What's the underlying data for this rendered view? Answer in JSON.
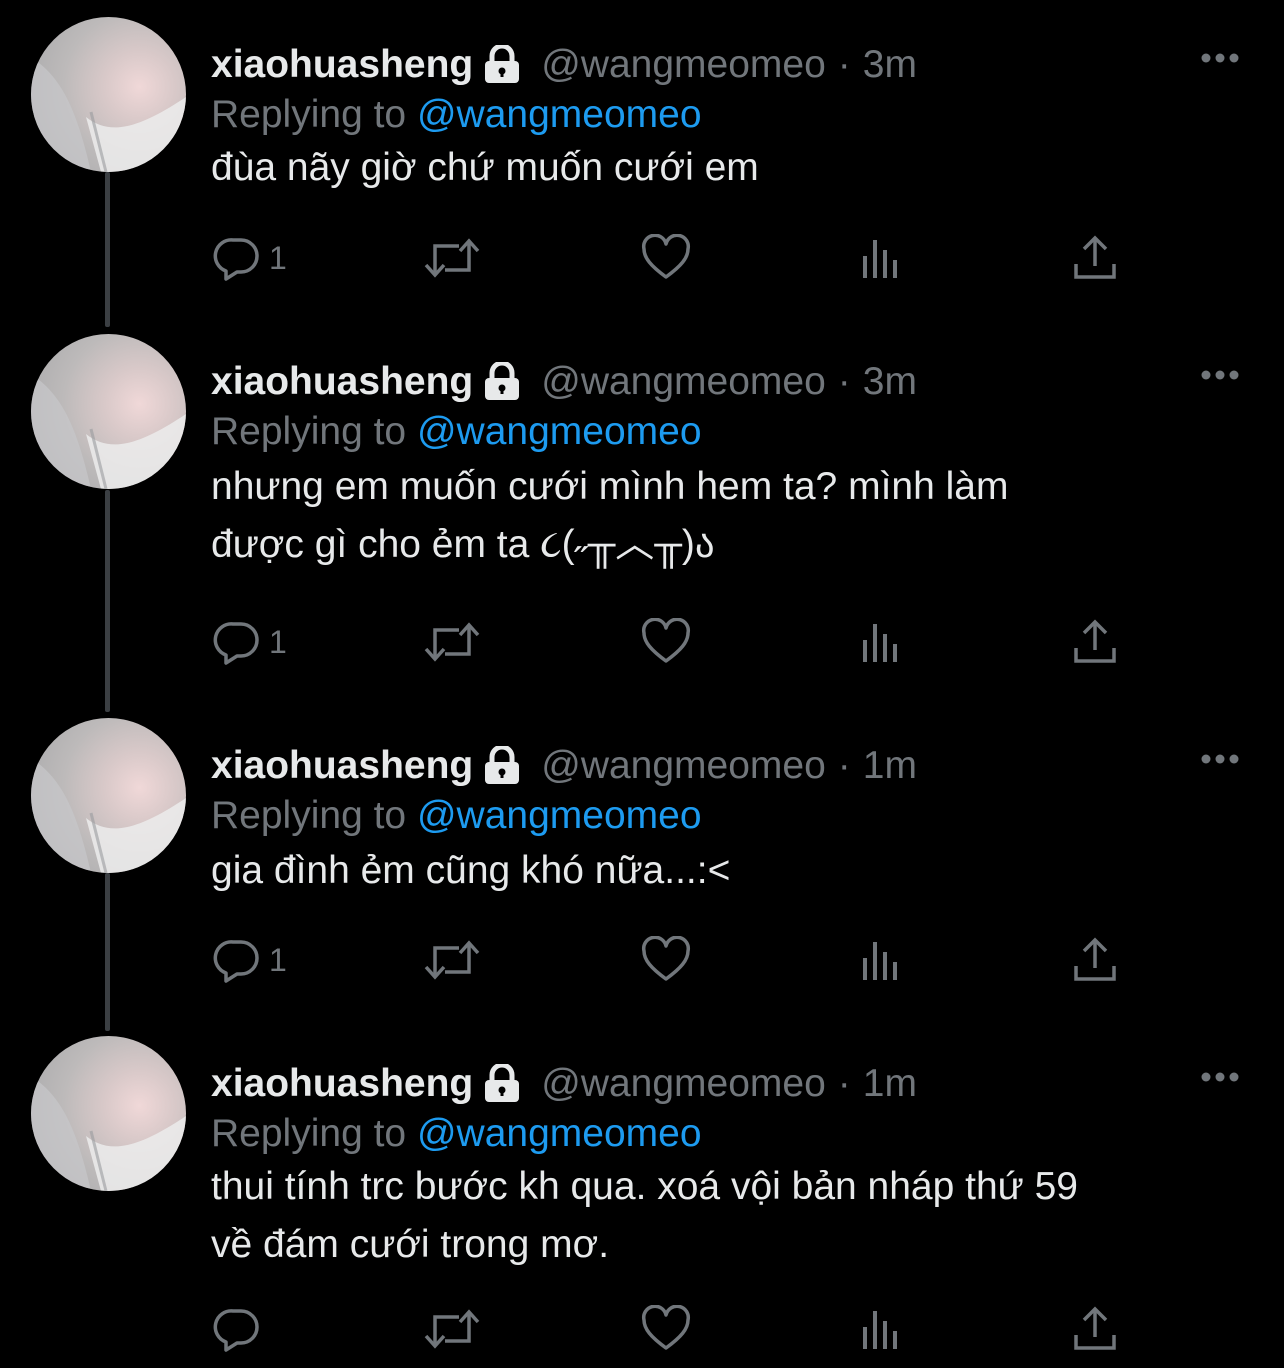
{
  "colors": {
    "background": "#000000",
    "text": "#e7e9ea",
    "muted": "#71767b",
    "mention": "#1d9bf0",
    "thread_line": "#3b3f43"
  },
  "tweets": [
    {
      "display_name": "xiaohuasheng",
      "handle": "@wangmeomeo",
      "separator": "·",
      "time": "3m",
      "replying_prefix": "Replying to",
      "replying_handle": "@wangmeomeo",
      "text": "đùa nãy giờ chứ muốn cưới em",
      "reply_count": "1",
      "icons": [
        "lock-icon",
        "more-icon",
        "reply-icon",
        "retweet-icon",
        "like-icon",
        "views-icon",
        "share-icon"
      ]
    },
    {
      "display_name": "xiaohuasheng",
      "handle": "@wangmeomeo",
      "separator": "·",
      "time": "3m",
      "replying_prefix": "Replying to",
      "replying_handle": "@wangmeomeo",
      "text": "nhưng em muốn cưới mình hem ta? mình làm\nđược gì cho ẻm ta ૮(˶╥︿╥)ა",
      "reply_count": "1"
    },
    {
      "display_name": "xiaohuasheng",
      "handle": "@wangmeomeo",
      "separator": "·",
      "time": "1m",
      "replying_prefix": "Replying to",
      "replying_handle": "@wangmeomeo",
      "text": "gia đình ẻm cũng khó nữa...:<",
      "reply_count": "1"
    },
    {
      "display_name": "xiaohuasheng",
      "handle": "@wangmeomeo",
      "separator": "·",
      "time": "1m",
      "replying_prefix": "Replying to",
      "replying_handle": "@wangmeomeo",
      "text": "thui tính trc bước kh qua. xoá vội bản nháp thứ 59\nvề đám cưới trong mơ.",
      "reply_count": ""
    }
  ]
}
